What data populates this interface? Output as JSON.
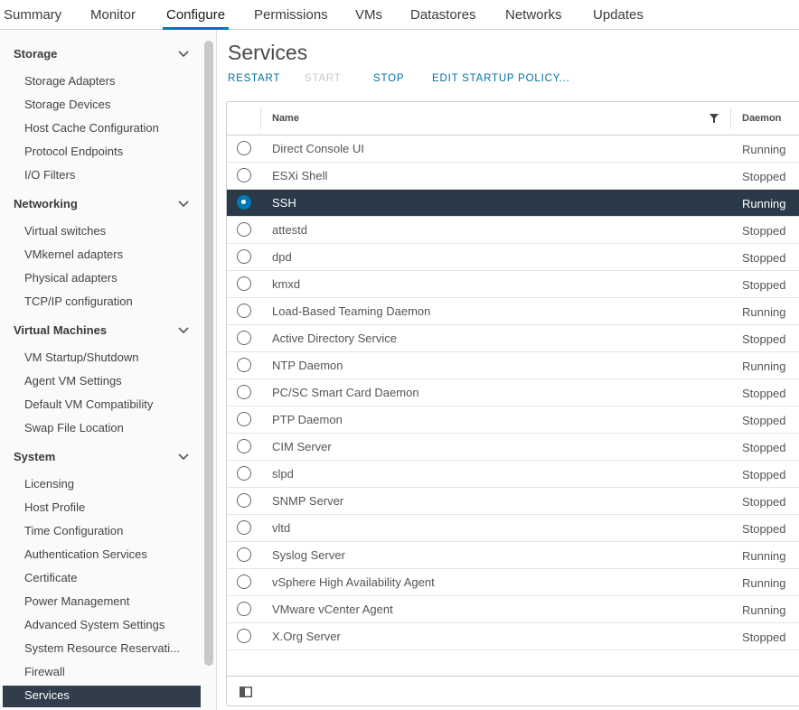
{
  "tabs": [
    {
      "label": "Summary"
    },
    {
      "label": "Monitor"
    },
    {
      "label": "Configure"
    },
    {
      "label": "Permissions"
    },
    {
      "label": "VMs"
    },
    {
      "label": "Datastores"
    },
    {
      "label": "Networks"
    },
    {
      "label": "Updates"
    }
  ],
  "active_tab": "Configure",
  "sidebar": {
    "sections": [
      {
        "label": "Storage",
        "items": [
          "Storage Adapters",
          "Storage Devices",
          "Host Cache Configuration",
          "Protocol Endpoints",
          "I/O Filters"
        ]
      },
      {
        "label": "Networking",
        "items": [
          "Virtual switches",
          "VMkernel adapters",
          "Physical adapters",
          "TCP/IP configuration"
        ]
      },
      {
        "label": "Virtual Machines",
        "items": [
          "VM Startup/Shutdown",
          "Agent VM Settings",
          "Default VM Compatibility",
          "Swap File Location"
        ]
      },
      {
        "label": "System",
        "items": [
          "Licensing",
          "Host Profile",
          "Time Configuration",
          "Authentication Services",
          "Certificate",
          "Power Management",
          "Advanced System Settings",
          "System Resource Reservati...",
          "Firewall",
          "Services"
        ]
      }
    ],
    "selected_item": "Services"
  },
  "main": {
    "title": "Services",
    "actions": {
      "restart": "RESTART",
      "start": "START",
      "stop": "STOP",
      "edit_policy": "EDIT STARTUP POLICY..."
    },
    "table": {
      "columns": {
        "name": "Name",
        "daemon": "Daemon"
      },
      "rows": [
        {
          "name": "Direct Console UI",
          "daemon": "Running",
          "selected": false
        },
        {
          "name": "ESXi Shell",
          "daemon": "Stopped",
          "selected": false
        },
        {
          "name": "SSH",
          "daemon": "Running",
          "selected": true
        },
        {
          "name": "attestd",
          "daemon": "Stopped",
          "selected": false
        },
        {
          "name": "dpd",
          "daemon": "Stopped",
          "selected": false
        },
        {
          "name": "kmxd",
          "daemon": "Stopped",
          "selected": false
        },
        {
          "name": "Load-Based Teaming Daemon",
          "daemon": "Running",
          "selected": false
        },
        {
          "name": "Active Directory Service",
          "daemon": "Stopped",
          "selected": false
        },
        {
          "name": "NTP Daemon",
          "daemon": "Running",
          "selected": false
        },
        {
          "name": "PC/SC Smart Card Daemon",
          "daemon": "Stopped",
          "selected": false
        },
        {
          "name": "PTP Daemon",
          "daemon": "Stopped",
          "selected": false
        },
        {
          "name": "CIM Server",
          "daemon": "Stopped",
          "selected": false
        },
        {
          "name": "slpd",
          "daemon": "Stopped",
          "selected": false
        },
        {
          "name": "SNMP Server",
          "daemon": "Stopped",
          "selected": false
        },
        {
          "name": "vltd",
          "daemon": "Stopped",
          "selected": false
        },
        {
          "name": "Syslog Server",
          "daemon": "Running",
          "selected": false
        },
        {
          "name": "vSphere High Availability Agent",
          "daemon": "Running",
          "selected": false
        },
        {
          "name": "VMware vCenter Agent",
          "daemon": "Running",
          "selected": false
        },
        {
          "name": "X.Org Server",
          "daemon": "Stopped",
          "selected": false
        }
      ]
    },
    "footer": {
      "icons": [
        "column-toggle-icon"
      ]
    }
  },
  "colors": {
    "accent": "#0079b8",
    "link": "#0072a3",
    "selected_row": "#2b3a49",
    "selected_nav": "#313d4a"
  }
}
